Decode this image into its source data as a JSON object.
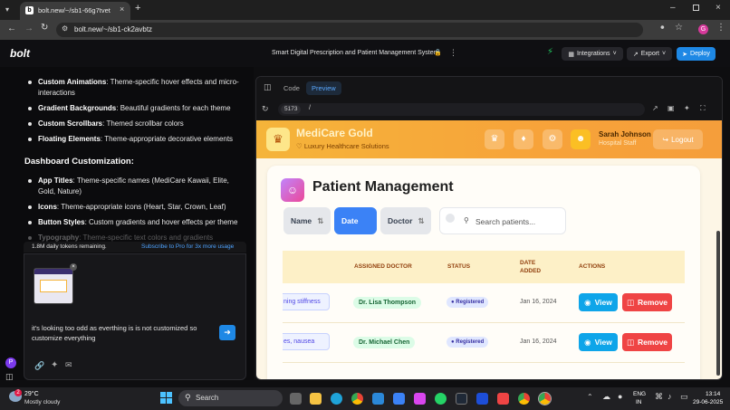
{
  "browser": {
    "tab_title": "bolt.new/~/sb1-66g7tvet",
    "url": "bolt.new/~/sb1-ck2avbtz"
  },
  "bolt": {
    "logo": "bolt",
    "project_title": "Smart Digital Prescription and Patient Management System",
    "integrations": "Integrations",
    "export": "Export",
    "deploy": "Deploy"
  },
  "chat": {
    "faded_top": "",
    "items1": [
      {
        "bold": "Custom Animations",
        "text": ": Theme-specific hover effects and micro-interactions"
      },
      {
        "bold": "Gradient Backgrounds",
        "text": ": Beautiful gradients for each theme"
      },
      {
        "bold": "Custom Scrollbars",
        "text": ": Themed scrollbar colors"
      },
      {
        "bold": "Floating Elements",
        "text": ": Theme-appropriate decorative elements"
      }
    ],
    "section_heading": "Dashboard Customization:",
    "items2": [
      {
        "bold": "App Titles",
        "text": ": Theme-specific names (MediCare Kawaii, Elite, Gold, Nature)"
      },
      {
        "bold": "Icons",
        "text": ": Theme-appropriate icons (Heart, Star, Crown, Leaf)"
      },
      {
        "bold": "Button Styles",
        "text": ": Custom gradients and hover effects per theme"
      },
      {
        "bold": "Typography",
        "text": ": Theme-specific text colors and gradients"
      }
    ],
    "tokens": "1.8M daily tokens remaining.",
    "subscribe": "Subscribe to Pro for 3x more usage",
    "message": "it's looking too odd as everthing is is not customized so customize everything",
    "avatar_letter": "P"
  },
  "preview": {
    "tab_code": "Code",
    "tab_preview": "Preview",
    "port": "5173",
    "path": "/",
    "app_name": "MediCare Gold",
    "app_sub": "Luxury Healthcare Solutions",
    "user_name": "Sarah Johnson",
    "user_role": "Hospital Staff",
    "logout": "Logout",
    "page_title": "Patient Management",
    "sort_name": "Name",
    "sort_date": "Date",
    "sort_doctor": "Doctor",
    "search_placeholder": "Search patients...",
    "columns": [
      "ASSIGNED DOCTOR",
      "STATUS",
      "DATE ADDED",
      "ACTIONS"
    ],
    "rows": [
      {
        "symptom": "ning stiffness",
        "doctor": "Dr. Lisa Thompson",
        "status": "Registered",
        "date": "Jan 16, 2024"
      },
      {
        "symptom": "es, nausea",
        "doctor": "Dr. Michael Chen",
        "status": "Registered",
        "date": "Jan 16, 2024"
      }
    ],
    "view": "View",
    "remove": "Remove"
  },
  "taskbar": {
    "weather_temp": "29°C",
    "weather_desc": "Mostly cloudy",
    "search": "Search",
    "lang1": "ENG",
    "lang2": "IN",
    "time": "13:14",
    "date": "29-06-2025",
    "badge": "2"
  },
  "colors": {
    "gold": "#f5b43a",
    "date_active": "#3b82f6",
    "view": "#0ea5e9",
    "remove": "#ef4444",
    "deploy": "#1e88e5"
  }
}
